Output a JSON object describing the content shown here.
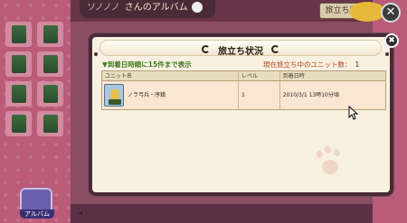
{
  "background": {
    "album_title_suffix": "さんのアルバム",
    "album_owner_name": "ソノノノ",
    "top_button_label": "旅立ち状況",
    "close_symbol": "✕",
    "album_button_label": "アルバム",
    "page_indicator": "◀ 1"
  },
  "dialog": {
    "title": "旅立ち状況",
    "close_symbol": "✖",
    "info_left": "▼到着日時順に15件まで表示",
    "info_right_label": "現在旅立ち中のユニット数：",
    "info_right_count": "1",
    "table": {
      "columns": [
        "ユニット名",
        "レベル",
        "到着日時"
      ],
      "rows": [
        {
          "unit_name": "ノラ弓兵・序鎮",
          "level": "1",
          "arrival": "2010/3/1 13時10分頃",
          "icon": "unit-portrait-icon"
        }
      ]
    }
  },
  "colors": {
    "frame": "#4a2a36",
    "dialog_bg": "#f8f1e2",
    "row_bg": "#f9e7d2",
    "header_bg": "#e9dcc0",
    "info_green": "#3f7a22",
    "info_orange": "#b5421f"
  }
}
